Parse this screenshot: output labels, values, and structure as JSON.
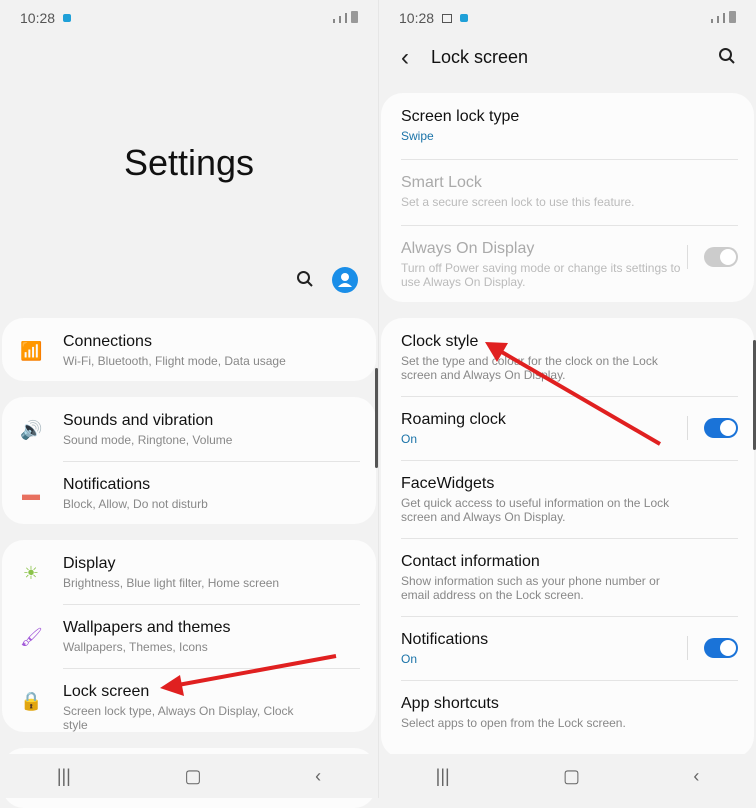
{
  "left": {
    "time": "10:28",
    "title": "Settings",
    "items": [
      {
        "label": "Connections",
        "sub": "Wi-Fi, Bluetooth, Flight mode, Data usage",
        "icon": "wifi-icon",
        "color": "#4a90d9"
      },
      {
        "label": "Sounds and vibration",
        "sub": "Sound mode, Ringtone, Volume",
        "icon": "speaker-icon",
        "color": "#7b6fd6"
      },
      {
        "label": "Notifications",
        "sub": "Block, Allow, Do not disturb",
        "icon": "notification-icon",
        "color": "#e8705f"
      },
      {
        "label": "Display",
        "sub": "Brightness, Blue light filter, Home screen",
        "icon": "sun-icon",
        "color": "#8bc34a"
      },
      {
        "label": "Wallpapers and themes",
        "sub": "Wallpapers, Themes, Icons",
        "icon": "brush-icon",
        "color": "#a259d9"
      },
      {
        "label": "Lock screen",
        "sub": "Screen lock type, Always On Display, Clock style",
        "icon": "lock-icon",
        "color": "#a27be0"
      }
    ]
  },
  "right": {
    "time": "10:28",
    "title": "Lock screen",
    "items": [
      {
        "label": "Screen lock type",
        "sub": "Swipe"
      },
      {
        "label": "Smart Lock",
        "sub": "Set a secure screen lock to use this feature."
      },
      {
        "label": "Always On Display",
        "sub": "Turn off Power saving mode or change its settings to use Always On Display.",
        "toggle": false
      },
      {
        "label": "Clock style",
        "sub": "Set the type and colour for the clock on the Lock screen and Always On Display."
      },
      {
        "label": "Roaming clock",
        "sub": "On",
        "toggle": true
      },
      {
        "label": "FaceWidgets",
        "sub": "Get quick access to useful information on the Lock screen and Always On Display."
      },
      {
        "label": "Contact information",
        "sub": "Show information such as your phone number or email address on the Lock screen."
      },
      {
        "label": "Notifications",
        "sub": "On",
        "toggle": true
      },
      {
        "label": "App shortcuts",
        "sub": "Select apps to open from the Lock screen."
      }
    ]
  },
  "accent": "#1a73d8",
  "arrow_color": "#e02020"
}
